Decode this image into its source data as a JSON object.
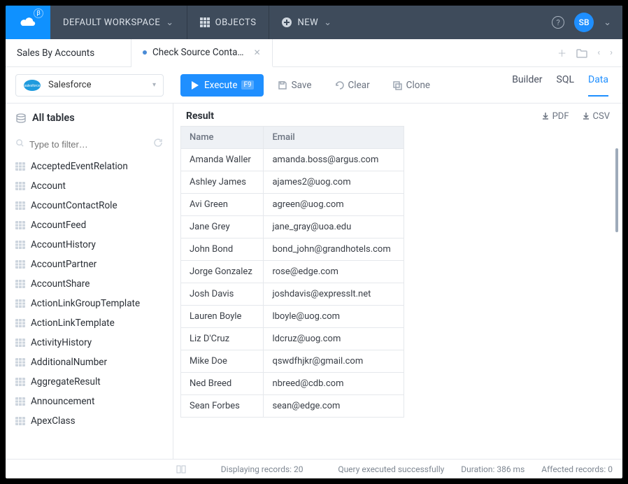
{
  "nav": {
    "workspace": "DEFAULT WORKSPACE",
    "objects": "OBJECTS",
    "new": "NEW",
    "avatar": "SB"
  },
  "tabs": {
    "t1": "Sales By Accounts",
    "t2": "Check Source Conta…"
  },
  "connection": {
    "name": "Salesforce"
  },
  "toolbar": {
    "execute": "Execute",
    "execute_kbd": "F9",
    "save": "Save",
    "clear": "Clear",
    "clone": "Clone"
  },
  "viewtabs": {
    "builder": "Builder",
    "sql": "SQL",
    "data": "Data"
  },
  "sidebar": {
    "heading": "All tables",
    "filter_placeholder": "Type to filter…",
    "tables": [
      "AcceptedEventRelation",
      "Account",
      "AccountContactRole",
      "AccountFeed",
      "AccountHistory",
      "AccountPartner",
      "AccountShare",
      "ActionLinkGroupTemplate",
      "ActionLinkTemplate",
      "ActivityHistory",
      "AdditionalNumber",
      "AggregateResult",
      "Announcement",
      "ApexClass"
    ]
  },
  "result": {
    "title": "Result",
    "export_pdf": "PDF",
    "export_csv": "CSV",
    "columns": {
      "c0": "Name",
      "c1": "Email"
    },
    "rows": [
      {
        "name": "Amanda Waller",
        "email": "amanda.boss@argus.com"
      },
      {
        "name": "Ashley James",
        "email": "ajames2@uog.com"
      },
      {
        "name": "Avi Green",
        "email": "agreen@uog.com"
      },
      {
        "name": "Jane Grey",
        "email": "jane_gray@uoa.edu"
      },
      {
        "name": "John Bond",
        "email": "bond_john@grandhotels.com"
      },
      {
        "name": "Jorge Gonzalez",
        "email": "rose@edge.com"
      },
      {
        "name": "Josh Davis",
        "email": "joshdavis@expresslt.net"
      },
      {
        "name": "Lauren Boyle",
        "email": "lboyle@uog.com"
      },
      {
        "name": "Liz D'Cruz",
        "email": "ldcruz@uog.com"
      },
      {
        "name": "Mike Doe",
        "email": "qswdfhjkr@gmail.com"
      },
      {
        "name": "Ned Breed",
        "email": "nbreed@cdb.com"
      },
      {
        "name": "Sean Forbes",
        "email": "sean@edge.com"
      }
    ]
  },
  "status": {
    "displaying": "Displaying records: 20",
    "msg": "Query executed successfully",
    "duration": "Duration: 386 ms",
    "affected": "Affected records: 0"
  }
}
